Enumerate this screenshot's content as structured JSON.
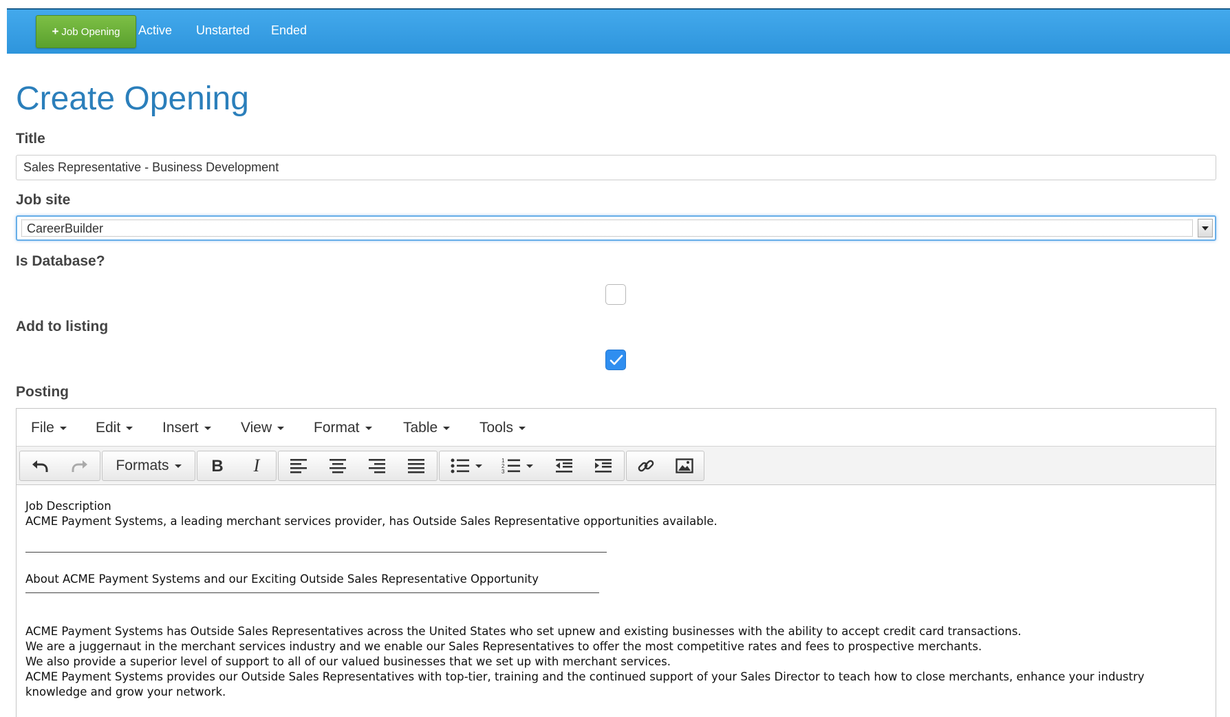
{
  "nav": {
    "new_button_plus": "+",
    "new_button_label": "Job Opening",
    "links": [
      "Active",
      "Unstarted",
      "Ended"
    ]
  },
  "form": {
    "page_title": "Create Opening",
    "title_label": "Title",
    "title_value": "Sales Representative - Business Development",
    "job_site_label": "Job site",
    "job_site_value": "CareerBuilder",
    "is_database_label": "Is Database?",
    "is_database_checked": false,
    "add_to_listing_label": "Add to listing",
    "add_to_listing_checked": true,
    "posting_label": "Posting"
  },
  "editor": {
    "menus": [
      "File",
      "Edit",
      "Insert",
      "View",
      "Format",
      "Table",
      "Tools"
    ],
    "formats_label": "Formats",
    "toolbar_icons": [
      "undo-icon",
      "redo-icon",
      "bold-icon",
      "italic-icon",
      "align-left-icon",
      "align-center-icon",
      "align-right-icon",
      "align-justify-icon",
      "bullet-list-icon",
      "numbered-list-icon",
      "outdent-icon",
      "indent-icon",
      "link-icon",
      "image-icon"
    ],
    "content": {
      "heading": "Job Description",
      "intro": "ACME Payment Systems, a leading merchant services provider, has Outside Sales Representative opportunities available.",
      "about": "About ACME Payment Systems and our Exciting Outside Sales Representative Opportunity",
      "para1": "ACME Payment Systems has Outside Sales Representatives across the United States who set upnew and existing businesses with the ability to accept credit card transactions.",
      "para2": "We are a juggernaut in the merchant services industry and we enable our Sales Representatives to offer the most competitive rates and fees to prospective merchants.",
      "para3": "We also provide a superior level of support to all of our valued businesses that we set up with merchant services.",
      "para4": "ACME Payment Systems provides our Outside Sales Representatives with top-tier, training and the continued support of your Sales Director to teach how to close merchants, enhance your industry knowledge and grow your network."
    }
  },
  "colors": {
    "nav_bg": "#3aa0e6",
    "new_button_bg": "#6cb13a",
    "title_color": "#2b7fbb",
    "checkbox_on": "#2f8ef0"
  }
}
